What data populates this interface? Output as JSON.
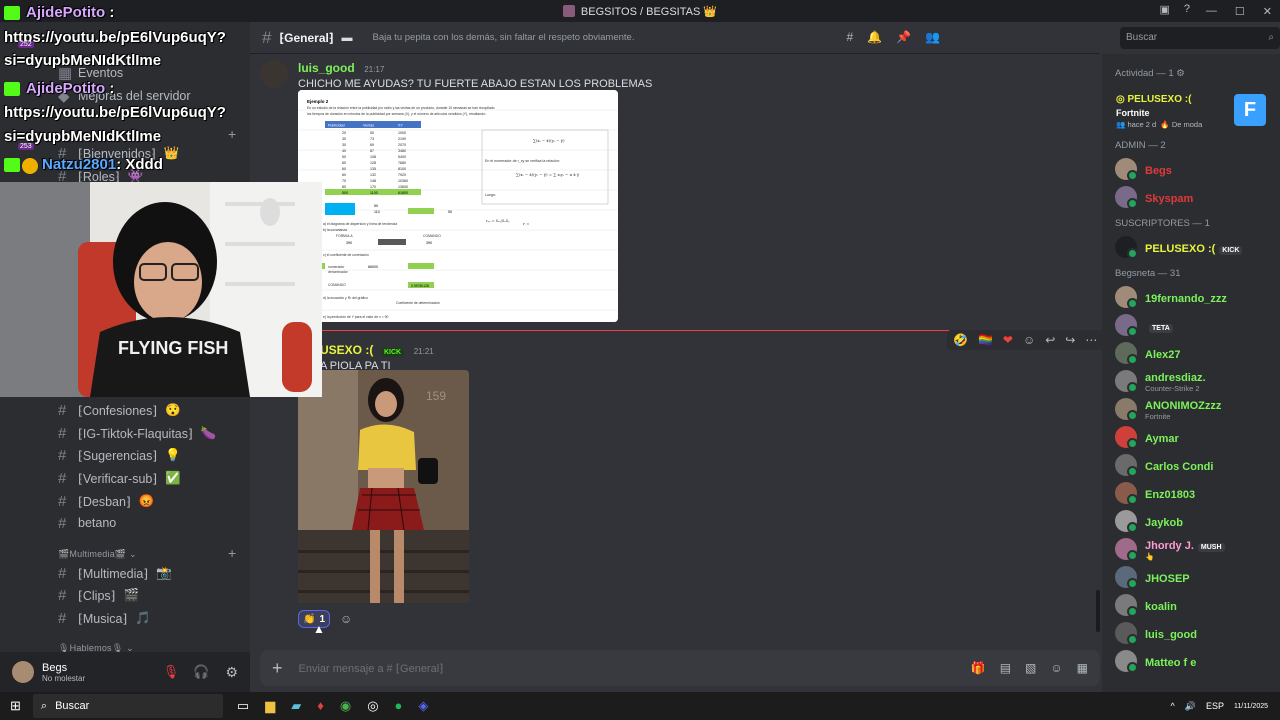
{
  "window": {
    "title": "BEGSITOS / BEGSITAS 👑"
  },
  "overlay": {
    "line1_user": "AjidePotito",
    "line1_sep": ":",
    "line2": "https://youtu.be/pE6lVup6uqY?",
    "line3": "si=dyupbMeNIdKtlIme",
    "line4_user": "AjidePotito",
    "line4_sep": ":",
    "line5": "https://youtu.be/pE6lVup6uqY?",
    "line6": "si=dyupbMeNIdKtlIme",
    "line7_user": "Natzu2801",
    "line7_text": ": Xddd",
    "badge_nums": [
      "252",
      "253"
    ]
  },
  "sidebar": {
    "items_top": [
      {
        "label": "Eventos"
      },
      {
        "label": "Mejoras del servidor"
      }
    ],
    "channels_top": [
      {
        "label": "⁅Bienvenidos⁆",
        "emoji": "👑"
      },
      {
        "label": "⁅Roles⁆",
        "emoji": "👾"
      }
    ],
    "channels": [
      {
        "label": "⁅Confesiones⁆",
        "emoji": "😯"
      },
      {
        "label": "⁅IG-Tiktok-Flaquitas⁆",
        "emoji": "🍆"
      },
      {
        "label": "⁅Sugerencias⁆",
        "emoji": "💡"
      },
      {
        "label": "⁅Verificar-sub⁆",
        "emoji": "✅"
      },
      {
        "label": "⁅Desban⁆",
        "emoji": "😡"
      },
      {
        "label": "betano",
        "emoji": ""
      }
    ],
    "category_media": "🎬Multimedia🎬",
    "media_channels": [
      {
        "label": "⁅Multimedia⁆",
        "emoji": "📸"
      },
      {
        "label": "⁅Clips⁆",
        "emoji": "🎬"
      },
      {
        "label": "⁅Musica⁆",
        "emoji": "🎵"
      }
    ],
    "category_talk": "🎙Hablemos🎙"
  },
  "user_panel": {
    "name": "Begs",
    "status": "No molestar"
  },
  "header": {
    "channel": "⁅General⁆",
    "topic": "Baja tu pepita con los demás, sin faltar el respeto obviamente.",
    "search_placeholder": "Buscar"
  },
  "messages": [
    {
      "author": "luis_good",
      "time": "21:17",
      "text": "CHICHO ME AYUDAS? TU FUERTE ABAJO ESTAN LOS PROBLEMAS",
      "attachment": "spreadsheet"
    },
    {
      "author": "PELUSEXO :(",
      "author_visible": "USEXO :(",
      "badge": "KICK",
      "time": "21:21",
      "text_visible": "A PIOLA PA TI",
      "attachment": "photo",
      "reaction_emoji": "👏",
      "reaction_count": "1"
    }
  ],
  "spreadsheet": {
    "heading": "Ejemplo 2",
    "lines": [
      "En un estudio de la relación entre la publicidad por radio y las ventas de un producto, durante 10 semanas se han recopilado",
      "los tiempos de duración en minutos de la publicidad por semana (X), y el número de artículos vendidos (Y), resultando:"
    ],
    "col_headers": [
      "Publicidad",
      "Ventas",
      "XY"
    ],
    "rows": [
      [
        "20",
        "50",
        "1000"
      ],
      [
        "30",
        "73",
        "2190"
      ],
      [
        "30",
        "69",
        "2070"
      ],
      [
        "40",
        "87",
        "3480"
      ],
      [
        "50",
        "108",
        "5400"
      ],
      [
        "60",
        "128",
        "7680"
      ],
      [
        "60",
        "135",
        "8100"
      ],
      [
        "60",
        "132",
        "7920"
      ],
      [
        "70",
        "148",
        "10360"
      ],
      [
        "80",
        "170",
        "13600"
      ]
    ],
    "totals": [
      "500",
      "1100",
      "61800"
    ],
    "note_lines": [
      "a) el diagrama de dispersión y línea de tendencia",
      "b) la covarianza",
      "c) el coeficiente de correlación",
      "d) la ecuación y R² del gráfico",
      "e) la predicción de Y para el valor de x = 90"
    ],
    "labels": [
      "FORMULA",
      "COMANDO",
      "numerador",
      "denominador",
      "COMANDO",
      "Coeficiente de determinación"
    ],
    "values": [
      "390",
      "390",
      "66000",
      "0.99780128",
      "50",
      "110",
      "50"
    ],
    "formula_text": "En el numerador de r_xy se verifica la relación:",
    "luego": "Luego:"
  },
  "composer": {
    "placeholder": "Enviar mensaje a # ⁅General⁆"
  },
  "members": {
    "activity_header": "Actividad — 1",
    "activity_user": "PELUSEXO :(",
    "activity_game": "Fortnite",
    "activity_time": "hace 2 d",
    "activity_tag": "De moda",
    "groups": [
      {
        "header": "ADMIN — 2",
        "members": [
          {
            "name": "Begs",
            "color": "#e03a3a",
            "sub": ""
          },
          {
            "name": "Skyspam",
            "color": "#e03a3a",
            "sub": ""
          }
        ]
      },
      {
        "header": "SUSCRIPTORES — 1",
        "members": [
          {
            "name": "PELUSEXO :(",
            "color": "#e8f53a",
            "sub": "",
            "badge": "KICK"
          }
        ]
      },
      {
        "header": "Begsneta — 31",
        "members": [
          {
            "name": "19fernando_zzz",
            "color": "#7cf25a",
            "sub": ""
          },
          {
            "name": "",
            "color": "#4752c4",
            "sub": "",
            "badge": "TETA"
          },
          {
            "name": "Alex27",
            "color": "#7cf25a",
            "sub": ""
          },
          {
            "name": "andresdiaz.",
            "color": "#7cf25a",
            "sub": "Counter-Strike 2"
          },
          {
            "name": "ANONIMOZzzz",
            "color": "#7cf25a",
            "sub": "Fortnite"
          },
          {
            "name": "Aymar",
            "color": "#7cf25a",
            "sub": ""
          },
          {
            "name": "Carlos Condi",
            "color": "#7cf25a",
            "sub": ""
          },
          {
            "name": "Enz01803",
            "color": "#7cf25a",
            "sub": ""
          },
          {
            "name": "Jaykob",
            "color": "#7cf25a",
            "sub": ""
          },
          {
            "name": "Jhordy J.",
            "color": "#ff9ad5",
            "sub": "👆",
            "badge": "MUSH"
          },
          {
            "name": "JHOSEP",
            "color": "#7cf25a",
            "sub": ""
          },
          {
            "name": "koalin",
            "color": "#7cf25a",
            "sub": ""
          },
          {
            "name": "luis_good",
            "color": "#7cf25a",
            "sub": ""
          },
          {
            "name": "Matteo f e",
            "color": "#7cf25a",
            "sub": ""
          }
        ]
      }
    ]
  },
  "taskbar": {
    "search": "Buscar",
    "lang": "ESP",
    "date": "11/11/2025"
  },
  "colors": {
    "accent": "#5865f2",
    "online": "#23a55a",
    "mention_green": "#7cf25a",
    "admin_red": "#e03a3a"
  }
}
